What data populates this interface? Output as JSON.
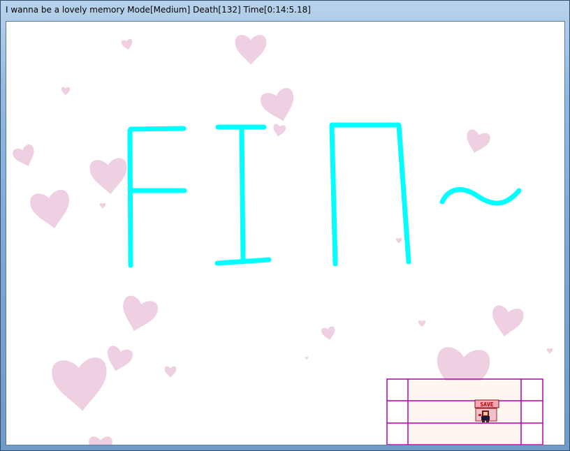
{
  "window": {
    "title": "I wanna be a lovely memory Mode[Medium] Death[132] Time[0:14:5.18]"
  },
  "game": {
    "ending_text": "FIN~",
    "ending_text_color": "#00ffff",
    "heart_color": "#efd0e3",
    "platform_border_color": "#b000b0",
    "platform_fill_color": "#fff6ef",
    "save_point": {
      "label": "SAVE",
      "icon": "save-point-icon",
      "player_icon": "kid-player-icon"
    }
  }
}
